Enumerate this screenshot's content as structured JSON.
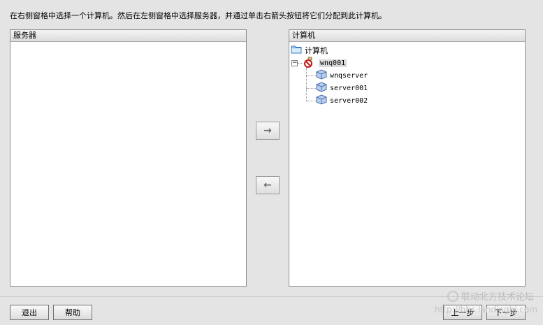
{
  "instruction": "在右侧窗格中选择一个计算机。然后在左侧窗格中选择服务器，并通过单击右箭头按钮将它们分配到此计算机。",
  "left_panel": {
    "header": "服务器"
  },
  "right_panel": {
    "header": "计算机",
    "tree": {
      "root": "计算机",
      "machine": "wnq001",
      "servers": [
        "wnqserver",
        "server001",
        "server002"
      ]
    }
  },
  "buttons": {
    "add": "→",
    "remove": "←",
    "exit": "退出",
    "help": "帮助",
    "back": "上一步",
    "next": "下一步"
  },
  "watermark": {
    "line1": "联动北方技术论坛",
    "line2": "http://bbs.landingbj.com"
  }
}
